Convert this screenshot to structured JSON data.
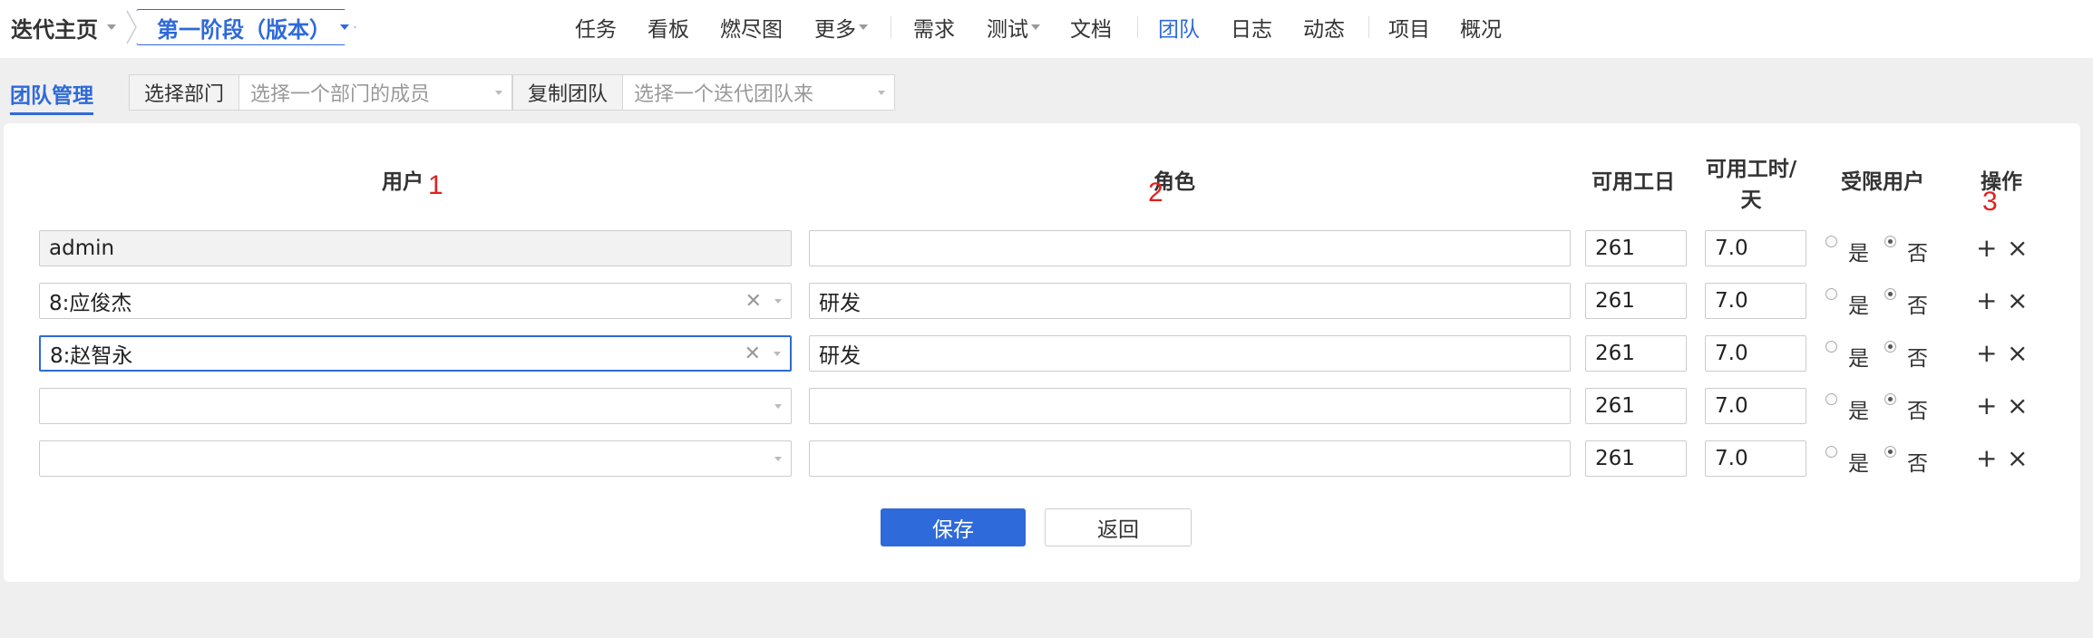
{
  "breadcrumb": {
    "home": "迭代主页",
    "current": "第一阶段（版本）"
  },
  "nav": [
    "任务",
    "看板",
    "燃尽图",
    "更多",
    "需求",
    "测试",
    "文档",
    "团队",
    "日志",
    "动态",
    "项目",
    "概况"
  ],
  "nav_active": "团队",
  "subbar": {
    "title": "团队管理",
    "dept_label": "选择部门",
    "dept_placeholder": "选择一个部门的成员",
    "copy_label": "复制团队",
    "copy_placeholder": "选择一个迭代团队来"
  },
  "table": {
    "headers": {
      "user": "用户",
      "role": "角色",
      "days": "可用工日",
      "hours": "可用工时/天",
      "limited": "受限用户",
      "action": "操作"
    },
    "yes_label": "是",
    "no_label": "否",
    "rows": [
      {
        "user": "admin",
        "role": "",
        "days": "261",
        "hours": "7.0"
      },
      {
        "user": "8:应俊杰",
        "role": "研发",
        "days": "261",
        "hours": "7.0"
      },
      {
        "user": "8:赵智永",
        "role": "研发",
        "days": "261",
        "hours": "7.0"
      },
      {
        "user": "",
        "role": "",
        "days": "261",
        "hours": "7.0"
      },
      {
        "user": "",
        "role": "",
        "days": "261",
        "hours": "7.0"
      }
    ]
  },
  "annotations": [
    "1",
    "2",
    "3"
  ],
  "buttons": {
    "save": "保存",
    "back": "返回"
  },
  "colors": {
    "accent": "#2e6ad9",
    "annotation": "#e02020"
  }
}
